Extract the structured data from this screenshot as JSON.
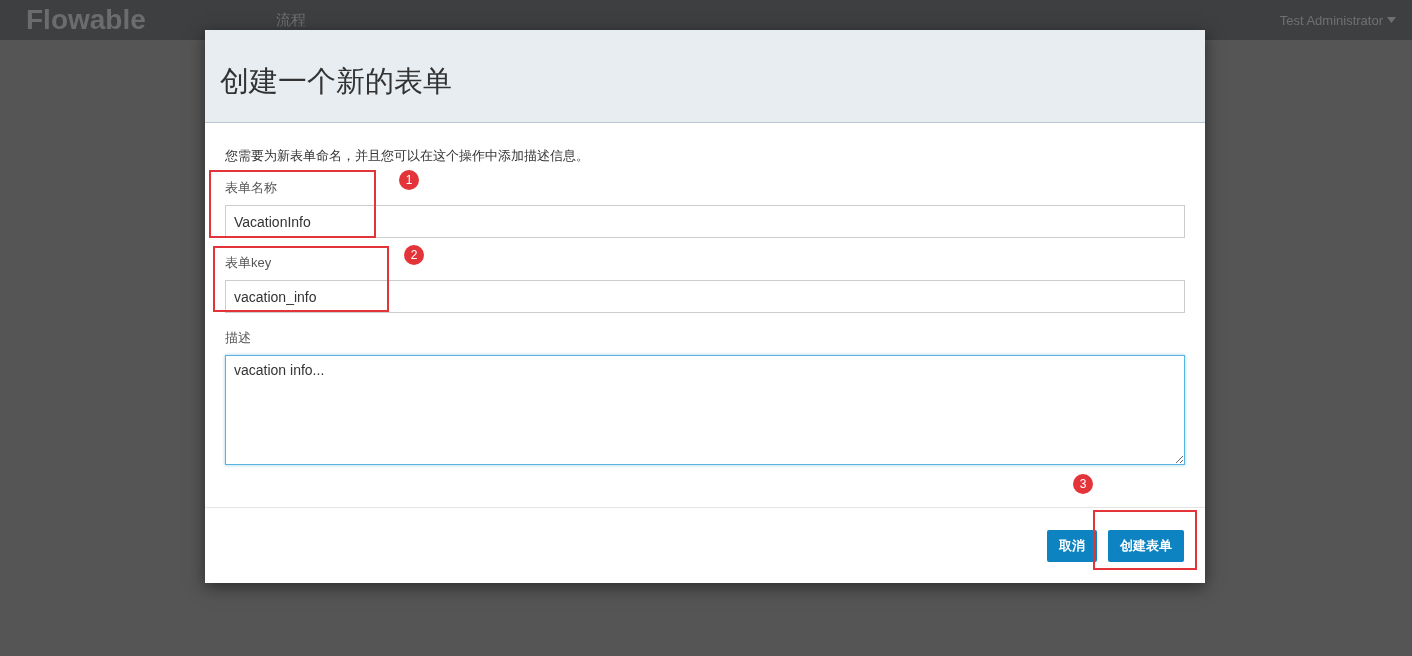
{
  "navbar": {
    "logo": "Flowable",
    "items": [
      {
        "label": "流程",
        "selected": false
      }
    ],
    "user": "Test Administrator"
  },
  "dialog": {
    "title": "创建一个新的表单",
    "description": "您需要为新表单命名，并且您可以在这个操作中添加描述信息。",
    "fields": [
      {
        "kind": "input",
        "label": "表单名称",
        "value": "VacationInfo",
        "focused": false
      },
      {
        "kind": "input",
        "label": "表单key",
        "value": "vacation_info",
        "focused": false
      },
      {
        "kind": "textarea",
        "label": "描述",
        "value": "vacation info...",
        "focused": true
      }
    ],
    "buttons": [
      "取消",
      "创建表单"
    ]
  },
  "annotations": [
    {
      "label": "1"
    },
    {
      "label": "2"
    },
    {
      "label": "3"
    }
  ]
}
